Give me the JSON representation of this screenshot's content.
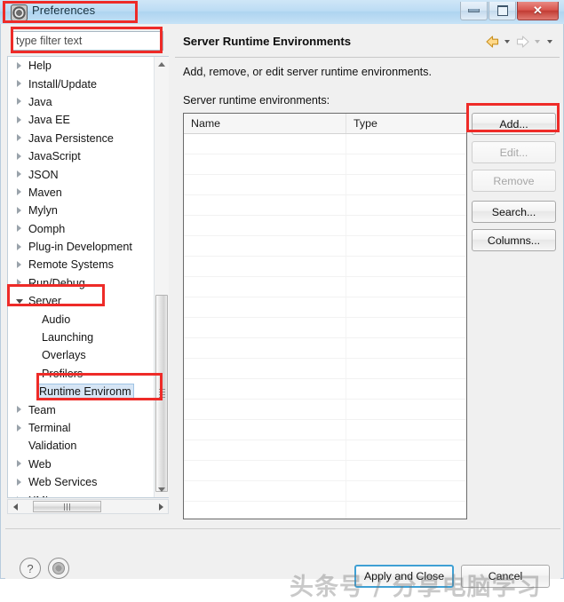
{
  "window": {
    "title": "Preferences",
    "icon": "preferences-gear-icon",
    "controls": {
      "minimize": "Minimize",
      "maximize": "Maximize",
      "close": "Close",
      "close_glyph": "✕"
    }
  },
  "filter": {
    "placeholder": "type filter text",
    "value": ""
  },
  "tree": {
    "items": [
      {
        "label": "Help",
        "level": 0,
        "state": "collapsed",
        "selected": false
      },
      {
        "label": "Install/Update",
        "level": 0,
        "state": "collapsed",
        "selected": false
      },
      {
        "label": "Java",
        "level": 0,
        "state": "collapsed",
        "selected": false
      },
      {
        "label": "Java EE",
        "level": 0,
        "state": "collapsed",
        "selected": false
      },
      {
        "label": "Java Persistence",
        "level": 0,
        "state": "collapsed",
        "selected": false
      },
      {
        "label": "JavaScript",
        "level": 0,
        "state": "collapsed",
        "selected": false
      },
      {
        "label": "JSON",
        "level": 0,
        "state": "collapsed",
        "selected": false
      },
      {
        "label": "Maven",
        "level": 0,
        "state": "collapsed",
        "selected": false
      },
      {
        "label": "Mylyn",
        "level": 0,
        "state": "collapsed",
        "selected": false
      },
      {
        "label": "Oomph",
        "level": 0,
        "state": "collapsed",
        "selected": false
      },
      {
        "label": "Plug-in Development",
        "level": 0,
        "state": "collapsed",
        "selected": false
      },
      {
        "label": "Remote Systems",
        "level": 0,
        "state": "collapsed",
        "selected": false
      },
      {
        "label": "Run/Debug",
        "level": 0,
        "state": "collapsed",
        "selected": false
      },
      {
        "label": "Server",
        "level": 0,
        "state": "expanded",
        "selected": false
      },
      {
        "label": "Audio",
        "level": 1,
        "state": "none",
        "selected": false
      },
      {
        "label": "Launching",
        "level": 1,
        "state": "none",
        "selected": false
      },
      {
        "label": "Overlays",
        "level": 1,
        "state": "none",
        "selected": false
      },
      {
        "label": "Profilers",
        "level": 1,
        "state": "none",
        "selected": false
      },
      {
        "label": "Runtime Environm",
        "level": 1,
        "state": "none",
        "selected": true
      },
      {
        "label": "Team",
        "level": 0,
        "state": "collapsed",
        "selected": false
      },
      {
        "label": "Terminal",
        "level": 0,
        "state": "collapsed",
        "selected": false
      },
      {
        "label": "Validation",
        "level": 0,
        "state": "none",
        "selected": false
      },
      {
        "label": "Web",
        "level": 0,
        "state": "collapsed",
        "selected": false
      },
      {
        "label": "Web Services",
        "level": 0,
        "state": "collapsed",
        "selected": false
      },
      {
        "label": "XML",
        "level": 0,
        "state": "collapsed",
        "selected": false
      }
    ]
  },
  "page": {
    "title": "Server Runtime Environments",
    "description": "Add, remove, or edit server runtime environments.",
    "list_label": "Server runtime environments:",
    "nav": {
      "back": "back-arrow-icon",
      "back_menu": "back-history-dropdown",
      "forward": "forward-arrow-icon",
      "forward_menu": "forward-history-dropdown",
      "view_menu": "view-menu-dropdown"
    },
    "table": {
      "columns": [
        "Name",
        "Type"
      ],
      "rows": [],
      "empty_row_count": 20
    },
    "buttons": [
      {
        "label": "Add...",
        "mnemonic": "A",
        "enabled": true,
        "highlighted": true
      },
      {
        "label": "Edit...",
        "mnemonic": "E",
        "enabled": false,
        "highlighted": false
      },
      {
        "label": "Remove",
        "mnemonic": "R",
        "enabled": false,
        "highlighted": false
      },
      {
        "label": "Search...",
        "mnemonic": "S",
        "enabled": true,
        "highlighted": false
      },
      {
        "label": "Columns...",
        "mnemonic": "C",
        "enabled": true,
        "highlighted": false
      }
    ]
  },
  "footer": {
    "help_icon": "question-mark-icon",
    "help_glyph": "?",
    "secondary_icon": "target-dot-icon",
    "apply_button": "Apply and Close",
    "cancel_button": "Cancel"
  },
  "watermark": {
    "text": "头条号 / 分享电脑学习"
  },
  "annotations": {
    "accent_color": "#ee2b28",
    "boxes": [
      {
        "name": "title-highlight"
      },
      {
        "name": "filter-highlight"
      },
      {
        "name": "server-node-highlight"
      },
      {
        "name": "runtime-environments-node-highlight"
      },
      {
        "name": "add-button-highlight"
      }
    ]
  }
}
